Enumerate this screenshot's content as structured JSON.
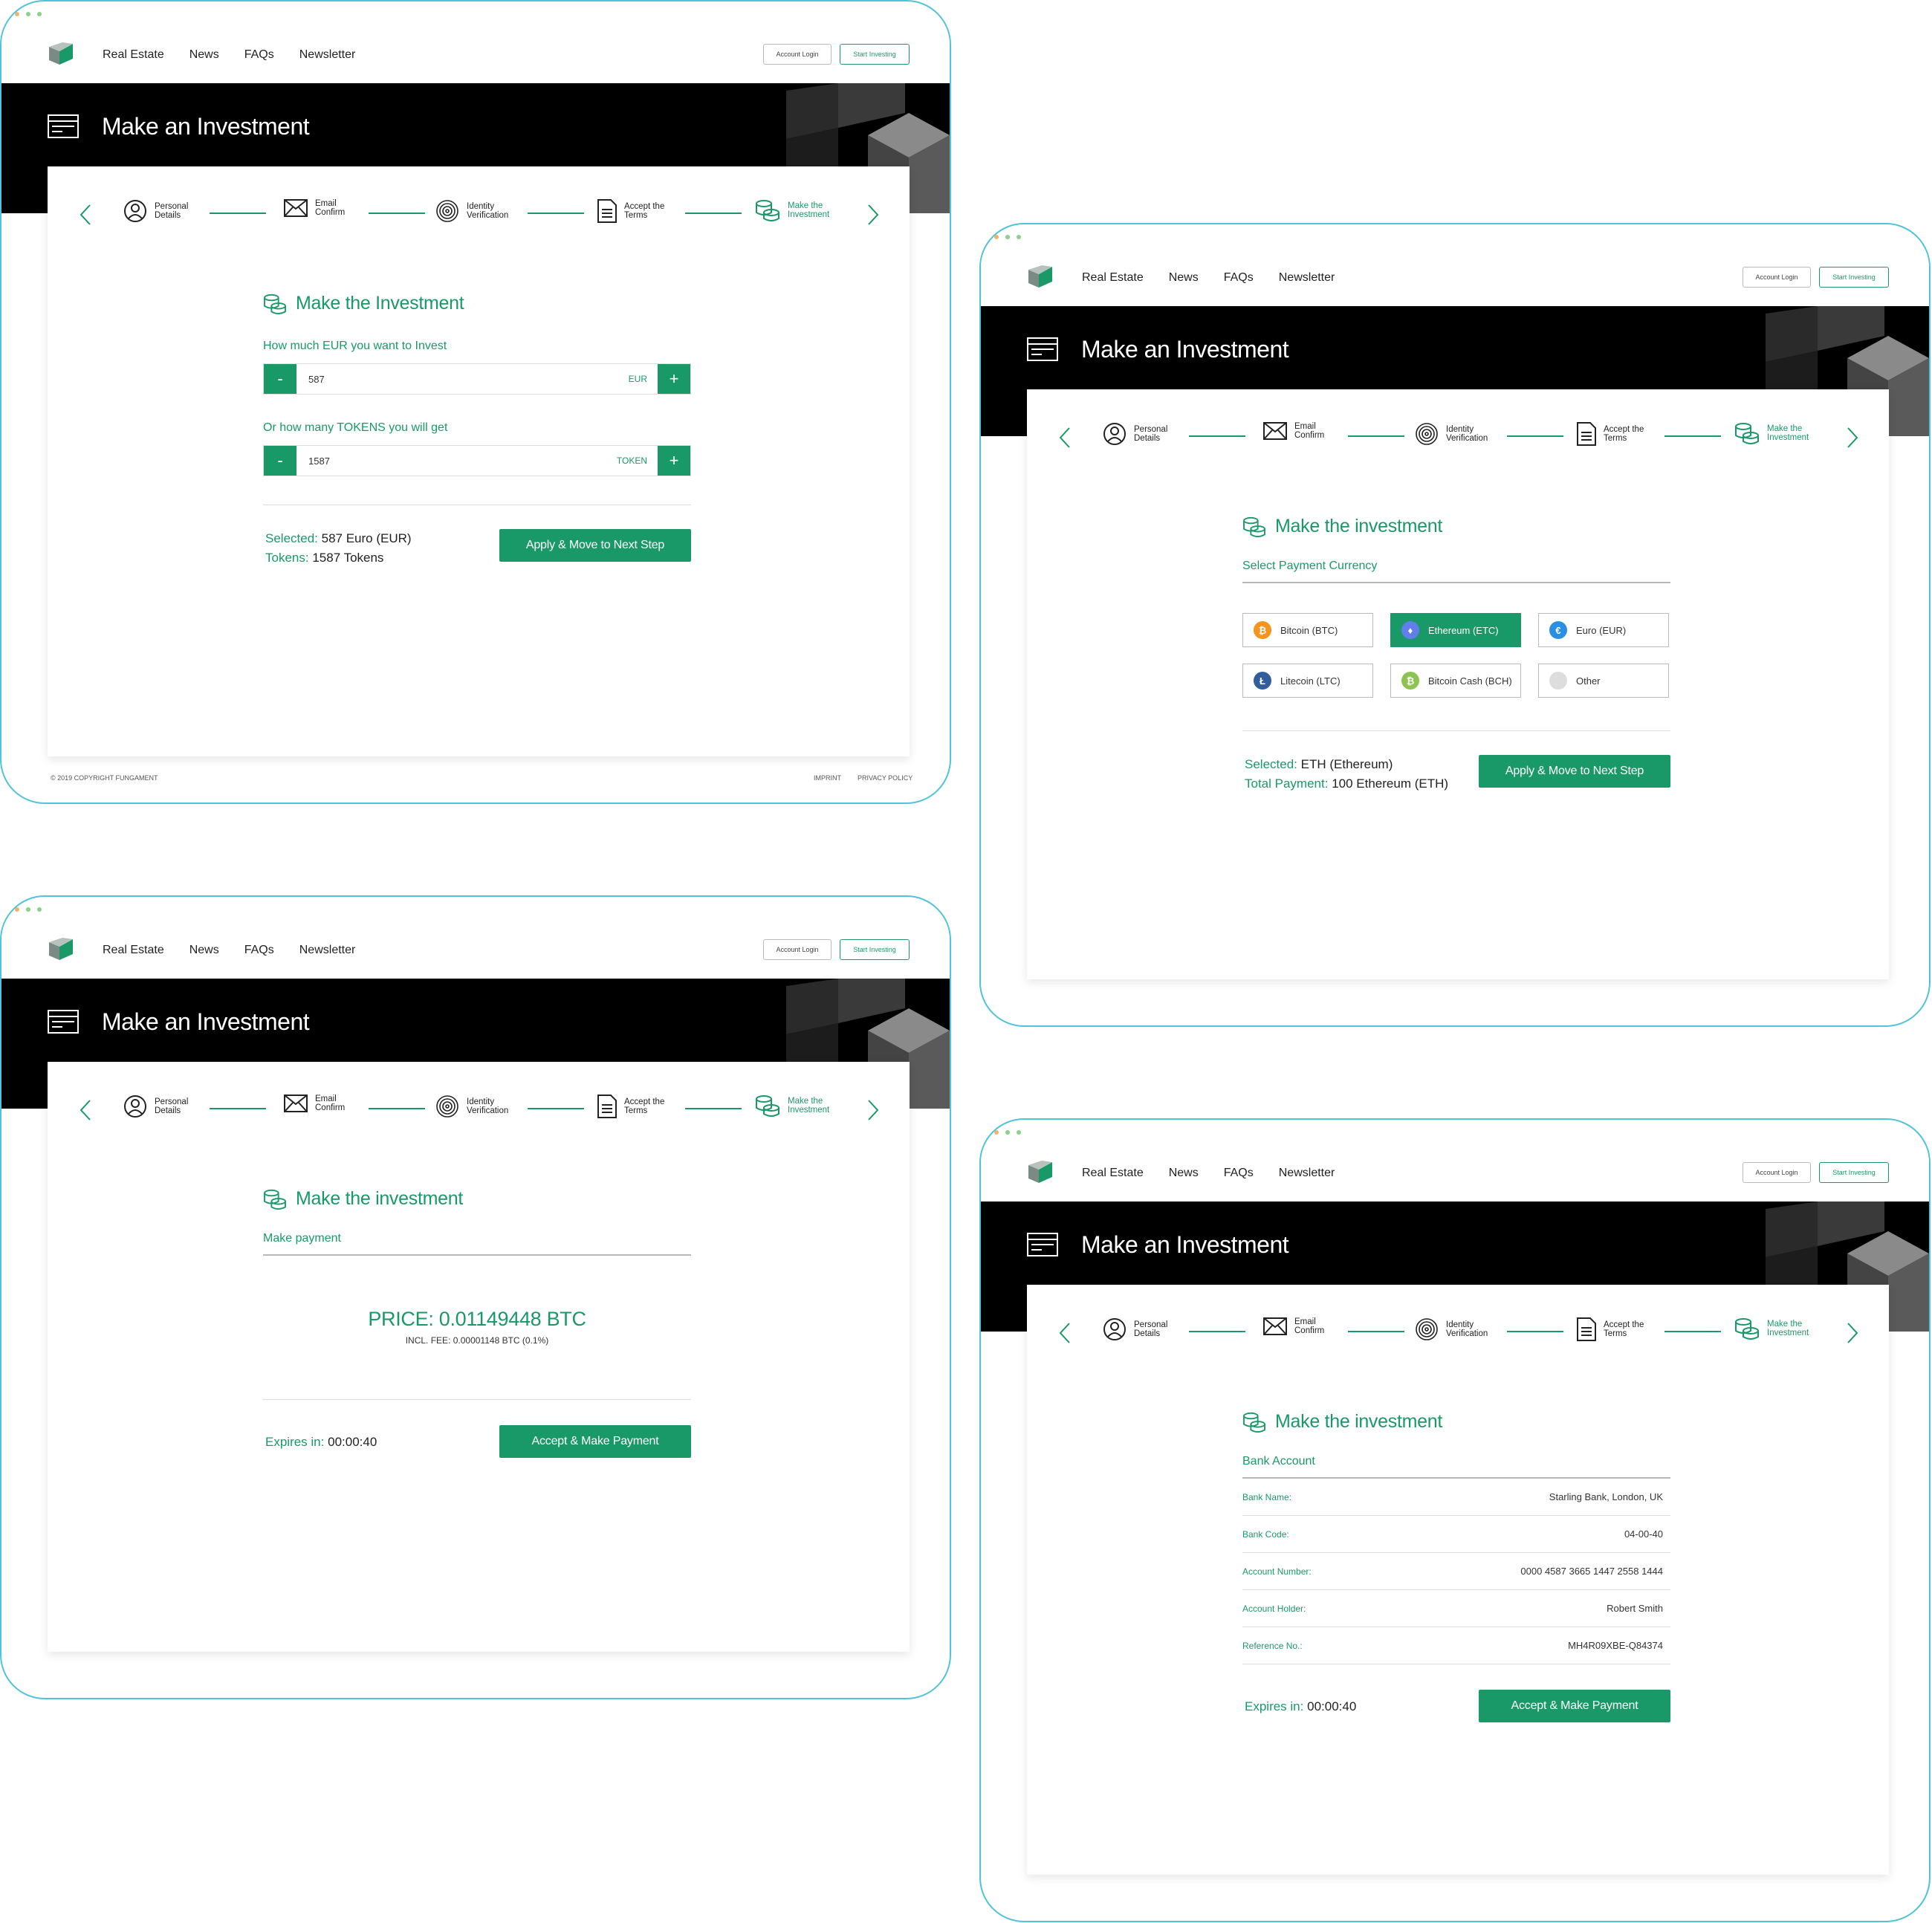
{
  "nav": {
    "items": [
      "Real Estate",
      "News",
      "FAQs",
      "Newsletter"
    ],
    "login": "Account Login",
    "start": "Start Investing"
  },
  "hero": {
    "title": "Make an Investment"
  },
  "steps": [
    {
      "label": "Personal Details",
      "icon": "user-icon"
    },
    {
      "label": "Email Confirm",
      "icon": "envelope-icon"
    },
    {
      "label": "Identity Verification",
      "icon": "fingerprint-icon"
    },
    {
      "label": "Accept the Terms",
      "icon": "document-icon"
    },
    {
      "label": "Make the Investment",
      "icon": "coins-icon"
    }
  ],
  "colors": {
    "accent": "#1a9968",
    "hero_bg": "#000000",
    "frame": "#4fc3d8"
  },
  "screen1": {
    "title": "Make the Investment",
    "eur_label": "How much EUR you want to Invest",
    "eur_value": "587",
    "eur_unit": "EUR",
    "token_label": "Or how many TOKENS you will get",
    "token_value": "1587",
    "token_unit": "TOKEN",
    "minus": "-",
    "plus": "+",
    "selected_label": "Selected:",
    "selected_value": "587 Euro (EUR)",
    "tokens_label": "Tokens:",
    "tokens_value": "1587 Tokens",
    "button": "Apply & Move to Next Step",
    "footer": {
      "copyright": "© 2019 COPYRIGHT FUNGAMENT",
      "imprint": "IMPRINT",
      "privacy": "PRIVACY POLICY"
    }
  },
  "screen2": {
    "title": "Make the investment",
    "subtitle": "Select Payment Currency",
    "currencies": [
      {
        "label": "Bitcoin (BTC)",
        "symbol": "₿",
        "color": "#f7931a",
        "selected": false
      },
      {
        "label": "Ethereum (ETC)",
        "symbol": "♦",
        "color": "#627eea",
        "selected": true
      },
      {
        "label": "Euro (EUR)",
        "symbol": "€",
        "color": "#2a8fe0",
        "selected": false
      },
      {
        "label": "Litecoin (LTC)",
        "symbol": "Ł",
        "color": "#345d9d",
        "selected": false
      },
      {
        "label": "Bitcoin Cash (BCH)",
        "symbol": "₿",
        "color": "#8dc351",
        "selected": false
      },
      {
        "label": "Other",
        "symbol": "",
        "color": "#dddddd",
        "selected": false
      }
    ],
    "selected_label": "Selected:",
    "selected_value": "ETH (Ethereum)",
    "total_label": "Total Payment:",
    "total_value": "100 Ethereum (ETH)",
    "button": "Apply & Move to Next Step"
  },
  "screen3": {
    "title": "Make the investment",
    "subtitle": "Make payment",
    "price": "PRICE: 0.01149448 BTC",
    "fee": "INCL. FEE: 0.00001148 BTC (0.1%)",
    "expires_label": "Expires in:",
    "expires_value": "00:00:40",
    "button": "Accept & Make Payment"
  },
  "screen4": {
    "title": "Make the investment",
    "subtitle": "Bank Account",
    "rows": [
      {
        "key": "Bank Name:",
        "value": "Starling Bank, London, UK"
      },
      {
        "key": "Bank Code:",
        "value": "04-00-40"
      },
      {
        "key": "Account Number:",
        "value": "0000 4587 3665 1447 2558 1444"
      },
      {
        "key": "Account Holder:",
        "value": "Robert Smith"
      },
      {
        "key": "Reference No.:",
        "value": "MH4R09XBE-Q84374"
      }
    ],
    "expires_label": "Expires in:",
    "expires_value": "00:00:40",
    "button": "Accept & Make Payment"
  }
}
